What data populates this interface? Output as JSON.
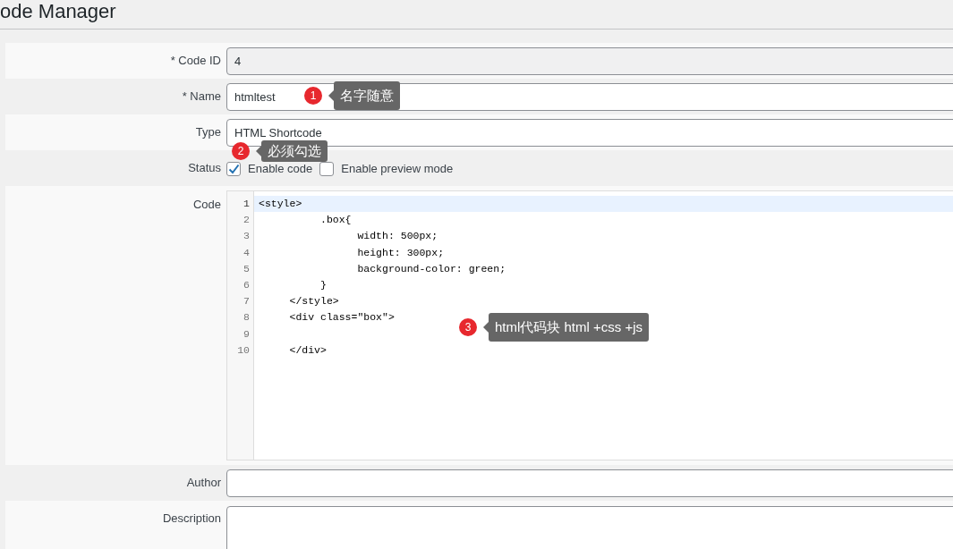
{
  "page_title": "ode Manager",
  "fields": [
    {
      "kind": "readonly",
      "label": "* Code ID",
      "value": "4"
    },
    {
      "kind": "text",
      "label": "* Name",
      "value": "htmltest"
    },
    {
      "kind": "text",
      "label": "Type",
      "value": "HTML Shortcode"
    },
    {
      "kind": "checks",
      "label": "Status",
      "options": [
        {
          "label": "Enable code",
          "checked": true
        },
        {
          "label": "Enable preview mode",
          "checked": false
        }
      ]
    },
    {
      "kind": "code",
      "label": "Code",
      "lines": [
        {
          "number": "1",
          "text": "<style>",
          "active": true
        },
        {
          "number": "2",
          "text": "          .box{",
          "active": false
        },
        {
          "number": "3",
          "text": "                width: 500px;",
          "active": false
        },
        {
          "number": "4",
          "text": "                height: 300px;",
          "active": false
        },
        {
          "number": "5",
          "text": "                background-color: green;",
          "active": false
        },
        {
          "number": "6",
          "text": "          }",
          "active": false
        },
        {
          "number": "7",
          "text": "     </style>",
          "active": false
        },
        {
          "number": "8",
          "text": "     <div class=\"box\">",
          "active": false
        },
        {
          "number": "9",
          "active": false
        },
        {
          "number": "10",
          "text": "     </div>",
          "active": false
        }
      ]
    },
    {
      "kind": "text",
      "label": "Author"
    },
    {
      "kind": "textarea",
      "label": "Description"
    }
  ],
  "annotations": [
    {
      "number": "1",
      "text": "名字随意"
    },
    {
      "number": "2",
      "text": "必须勾选"
    },
    {
      "number": "3",
      "text": "html代码块 html +css +js"
    }
  ]
}
